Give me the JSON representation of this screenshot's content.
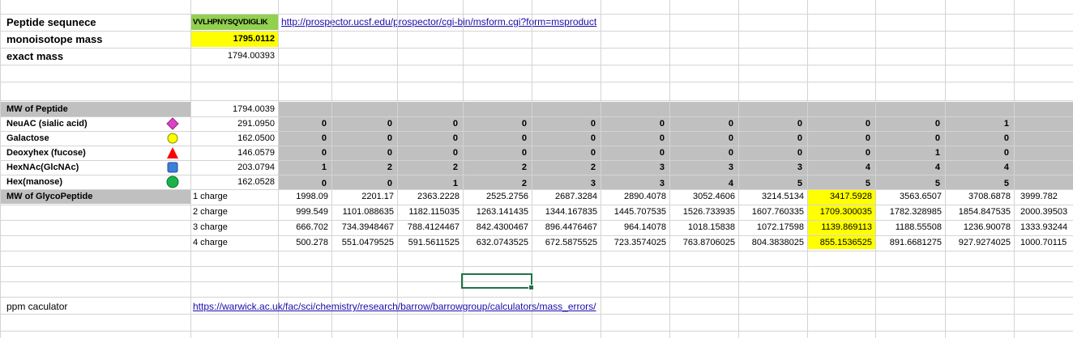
{
  "header_rows": {
    "peptide_label": "Peptide sequnece",
    "peptide_value": "VVLHPNYSQVDIGLIK",
    "prospector_link": "http://prospector.ucsf.edu/prospector/cgi-bin/msform.cgi?form=msproduct",
    "mono_label": "monoisotope mass",
    "mono_value": "1795.0112",
    "exact_label": "exact mass",
    "exact_value": "1794.00393"
  },
  "glyco_table": {
    "mw_peptide_label": "MW of Peptide",
    "mw_peptide_value": "1794.0039",
    "sugars": [
      {
        "label": "NeuAC (sialic acid)",
        "mass": "291.0950",
        "icon": "magenta-diamond-icon",
        "counts": [
          "0",
          "0",
          "0",
          "0",
          "0",
          "0",
          "0",
          "0",
          "0",
          "0",
          "1"
        ]
      },
      {
        "label": "Galactose",
        "mass": "162.0500",
        "icon": "yellow-circle-icon",
        "counts": [
          "0",
          "0",
          "0",
          "0",
          "0",
          "0",
          "0",
          "0",
          "0",
          "0",
          "0"
        ]
      },
      {
        "label": "Deoxyhex (fucose)",
        "mass": "146.0579",
        "icon": "red-triangle-icon",
        "counts": [
          "0",
          "0",
          "0",
          "0",
          "0",
          "0",
          "0",
          "0",
          "0",
          "1",
          "0"
        ]
      },
      {
        "label": "HexNAc(GlcNAc)",
        "mass": "203.0794",
        "icon": "blue-square-icon",
        "counts": [
          "1",
          "2",
          "2",
          "2",
          "2",
          "3",
          "3",
          "3",
          "4",
          "4",
          "4"
        ]
      },
      {
        "label": "Hex(manose)",
        "mass": "162.0528",
        "icon": "green-circle-icon",
        "counts": [
          "0",
          "0",
          "1",
          "2",
          "3",
          "3",
          "4",
          "5",
          "5",
          "5",
          "5"
        ]
      }
    ],
    "mw_glyco_label": "MW of GlycoPeptide",
    "charges": [
      {
        "label": "1  charge",
        "values": [
          "1998.09",
          "2201.17",
          "2363.2228",
          "2525.2756",
          "2687.3284",
          "2890.4078",
          "3052.4606",
          "3214.5134",
          "3417.5928",
          "3563.6507",
          "3708.6878",
          "3999.782"
        ]
      },
      {
        "label": "2 charge",
        "values": [
          "999.549",
          "1101.088635",
          "1182.115035",
          "1263.141435",
          "1344.167835",
          "1445.707535",
          "1526.733935",
          "1607.760335",
          "1709.300035",
          "1782.328985",
          "1854.847535",
          "2000.39503"
        ]
      },
      {
        "label": "3 charge",
        "values": [
          "666.702",
          "734.3948467",
          "788.4124467",
          "842.4300467",
          "896.4476467",
          "964.14078",
          "1018.15838",
          "1072.17598",
          "1139.869113",
          "1188.55508",
          "1236.90078",
          "1333.93244"
        ]
      },
      {
        "label": "4 charge",
        "values": [
          "500.278",
          "551.0479525",
          "591.5611525",
          "632.0743525",
          "672.5875525",
          "723.3574025",
          "763.8706025",
          "804.3838025",
          "855.1536525",
          "891.6681275",
          "927.9274025",
          "1000.70115"
        ]
      }
    ],
    "highlight_column_index": 8
  },
  "ppm": {
    "label": "ppm caculator",
    "link": "https://warwick.ac.uk/fac/sci/chemistry/research/barrow/barrowgroup/calculators/mass_errors/"
  },
  "colors": {
    "green_fill": "#92d050",
    "yellow_fill": "#ffff00",
    "gray_fill": "#c0c0c0",
    "selection": "#217346"
  }
}
